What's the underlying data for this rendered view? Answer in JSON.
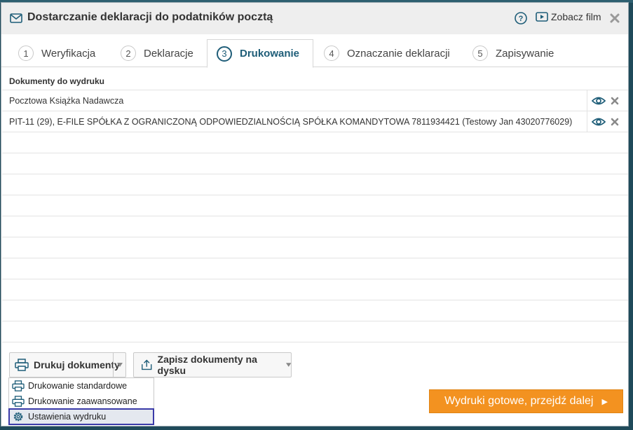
{
  "header": {
    "title": "Dostarczanie deklaracji do podatników pocztą",
    "film_label": "Zobacz film"
  },
  "tabs": [
    {
      "num": "1",
      "label": "Weryfikacja"
    },
    {
      "num": "2",
      "label": "Deklaracje"
    },
    {
      "num": "3",
      "label": "Drukowanie"
    },
    {
      "num": "4",
      "label": "Oznaczanie deklaracji"
    },
    {
      "num": "5",
      "label": "Zapisywanie"
    }
  ],
  "active_tab": 2,
  "grid": {
    "header": "Dokumenty do wydruku",
    "rows": [
      "Pocztowa Książka Nadawcza",
      "PIT-11 (29), E-FILE SPÓŁKA Z OGRANICZONĄ ODPOWIEDZIALNOŚCIĄ SPÓŁKA KOMANDYTOWA 7811934421 (Testowy Jan 43020776029)"
    ]
  },
  "toolbar": {
    "print_label": "Drukuj dokumenty",
    "save_label": "Zapisz dokumenty na dysku"
  },
  "print_menu": {
    "items": [
      "Drukowanie standardowe",
      "Drukowanie zaawansowane",
      "Ustawienia wydruku"
    ]
  },
  "next_button": {
    "label": "Wydruki gotowe, przejdź dalej"
  },
  "colors": {
    "accent": "#1e5d78",
    "action": "#f39220"
  }
}
